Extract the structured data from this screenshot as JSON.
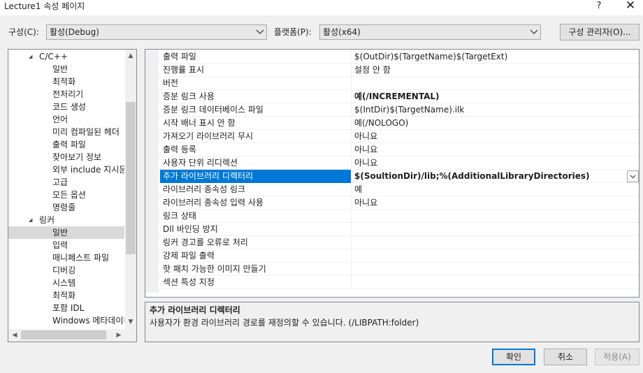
{
  "window": {
    "title": "Lecture1 속성 페이지",
    "help_label": "?",
    "close_label": "✕"
  },
  "toolbar": {
    "config_label": "구성(C):",
    "config_value": "활성(Debug)",
    "platform_label": "플랫폼(P):",
    "platform_value": "활성(x64)",
    "config_manager_label": "구성 관리자(O)..."
  },
  "tree": {
    "items": [
      {
        "label": "C/C++",
        "level": 0,
        "expanded": true
      },
      {
        "label": "일반",
        "level": 1
      },
      {
        "label": "최적화",
        "level": 1
      },
      {
        "label": "전처리기",
        "level": 1
      },
      {
        "label": "코드 생성",
        "level": 1
      },
      {
        "label": "언어",
        "level": 1
      },
      {
        "label": "미리 컴파일된 헤더",
        "level": 1
      },
      {
        "label": "출력 파일",
        "level": 1
      },
      {
        "label": "찾아보기 정보",
        "level": 1
      },
      {
        "label": "외부 include 지시문",
        "level": 1
      },
      {
        "label": "고급",
        "level": 1
      },
      {
        "label": "모든 옵션",
        "level": 1
      },
      {
        "label": "명령줄",
        "level": 1
      },
      {
        "label": "링커",
        "level": 0,
        "expanded": true
      },
      {
        "label": "일반",
        "level": 1,
        "selected": true
      },
      {
        "label": "입력",
        "level": 1
      },
      {
        "label": "매니페스트 파일",
        "level": 1
      },
      {
        "label": "디버깅",
        "level": 1
      },
      {
        "label": "시스템",
        "level": 1
      },
      {
        "label": "최적화",
        "level": 1
      },
      {
        "label": "포함 IDL",
        "level": 1
      },
      {
        "label": "Windows 메타데이터",
        "level": 1
      }
    ]
  },
  "grid": {
    "rows": [
      {
        "name": "출력 파일",
        "value": "$(OutDir)$(TargetName)$(TargetExt)"
      },
      {
        "name": "진행률 표시",
        "value": "설정 안 함"
      },
      {
        "name": "버전",
        "value": ""
      },
      {
        "name": "증분 링크 사용",
        "value": "예(/INCREMENTAL)",
        "bold": true
      },
      {
        "name": "증분 링크 데이터베이스 파일",
        "value": "$(IntDir)$(TargetName).ilk"
      },
      {
        "name": "시작 배너 표시 안 함",
        "value": "예(/NOLOGO)"
      },
      {
        "name": "가져오기 라이브러리 무시",
        "value": "아니요"
      },
      {
        "name": "출력 등록",
        "value": "아니요"
      },
      {
        "name": "사용자 단위 리디렉션",
        "value": "아니요"
      },
      {
        "name": "추가 라이브러리 디렉터리",
        "value": "$(SoultionDir)/lib;%(AdditionalLibraryDirectories)",
        "bold": true,
        "selected": true
      },
      {
        "name": "라이브러리 종속성 링크",
        "value": "예"
      },
      {
        "name": "라이브러리 종속성 입력 사용",
        "value": "아니요"
      },
      {
        "name": "링크 상태",
        "value": ""
      },
      {
        "name": "Dll 바인딩 방지",
        "value": ""
      },
      {
        "name": "링커 경고를 오류로 처리",
        "value": ""
      },
      {
        "name": "강제 파일 출력",
        "value": ""
      },
      {
        "name": "핫 패치 가능한 이미지 만들기",
        "value": ""
      },
      {
        "name": "섹션 특성 지정",
        "value": ""
      }
    ]
  },
  "description": {
    "title": "추가 라이브러리 디렉터리",
    "text": "사용자가 환경 라이브러리 경로를 재정의할 수 있습니다. (/LIBPATH:folder)"
  },
  "buttons": {
    "ok": "확인",
    "cancel": "취소",
    "apply": "적용(A)"
  },
  "colors": {
    "selection": "#0078d7",
    "tree_selection": "#d9d9d9",
    "window_bg": "#f0f0f0"
  }
}
